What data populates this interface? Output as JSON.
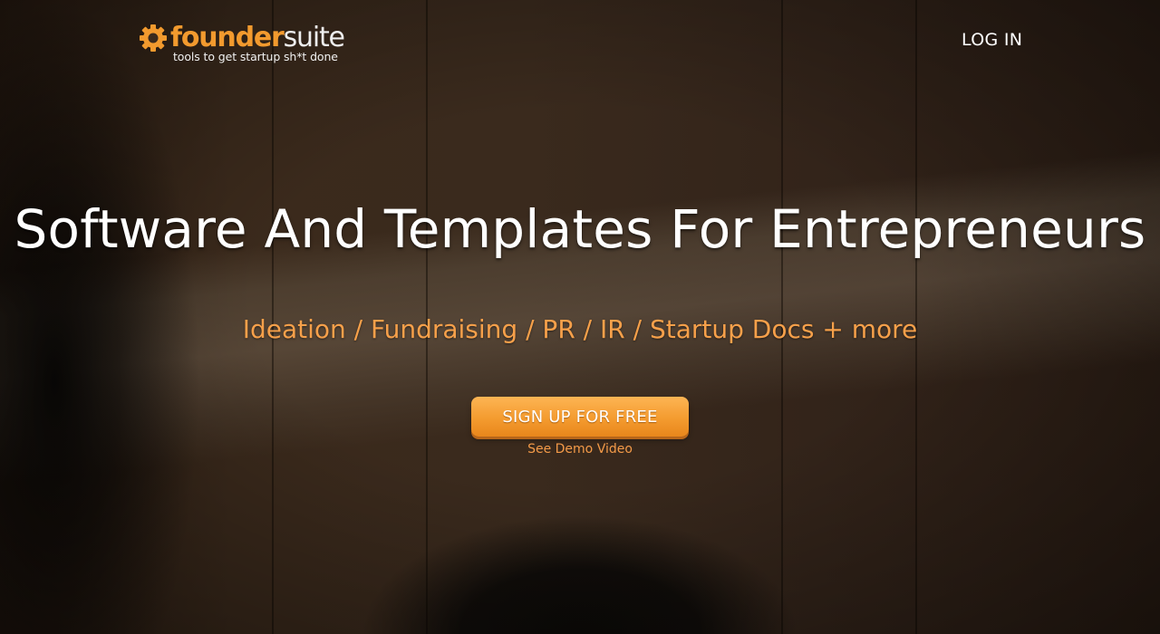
{
  "header": {
    "logo": {
      "word_part1": "founder",
      "word_part2": "suite",
      "tagline": "tools to get startup sh*t done",
      "icon": "gear-icon"
    },
    "login_label": "LOG IN"
  },
  "hero": {
    "title": "Software And Templates For Entrepreneurs",
    "subtitle": "Ideation / Fundraising / PR / IR / Startup Docs + more",
    "signup_label": "SIGN UP FOR FREE",
    "demo_link_label": "See Demo Video"
  },
  "colors": {
    "brand_orange": "#f29a2e",
    "subtitle_orange": "#f6a04a",
    "button_orange": "#f49b2f",
    "text_white": "#ffffff"
  }
}
